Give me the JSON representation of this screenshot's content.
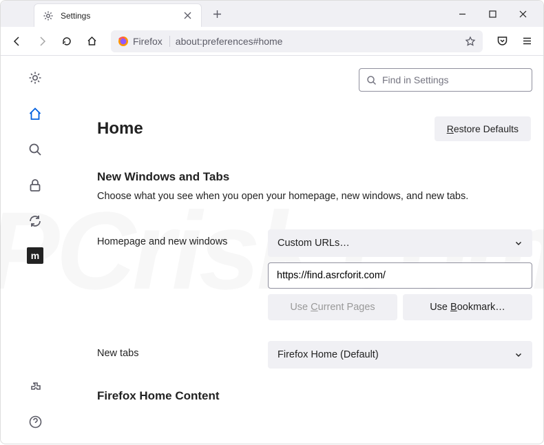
{
  "tab": {
    "title": "Settings"
  },
  "urlbar": {
    "identity": "Firefox",
    "url": "about:preferences#home"
  },
  "search": {
    "placeholder": "Find in Settings"
  },
  "page": {
    "title": "Home"
  },
  "buttons": {
    "restore": "Restore Defaults",
    "useCurrentPages": "Use Current Pages",
    "useBookmark": "Use Bookmark…"
  },
  "sections": {
    "newWinTabs": {
      "heading": "New Windows and Tabs",
      "desc": "Choose what you see when you open your homepage, new windows, and new tabs."
    },
    "homeContent": {
      "heading": "Firefox Home Content"
    }
  },
  "form": {
    "homepage": {
      "label": "Homepage and new windows",
      "dropdownValue": "Custom URLs…",
      "inputValue": "https://find.asrcforit.com/"
    },
    "newTabs": {
      "label": "New tabs",
      "dropdownValue": "Firefox Home (Default)"
    }
  }
}
